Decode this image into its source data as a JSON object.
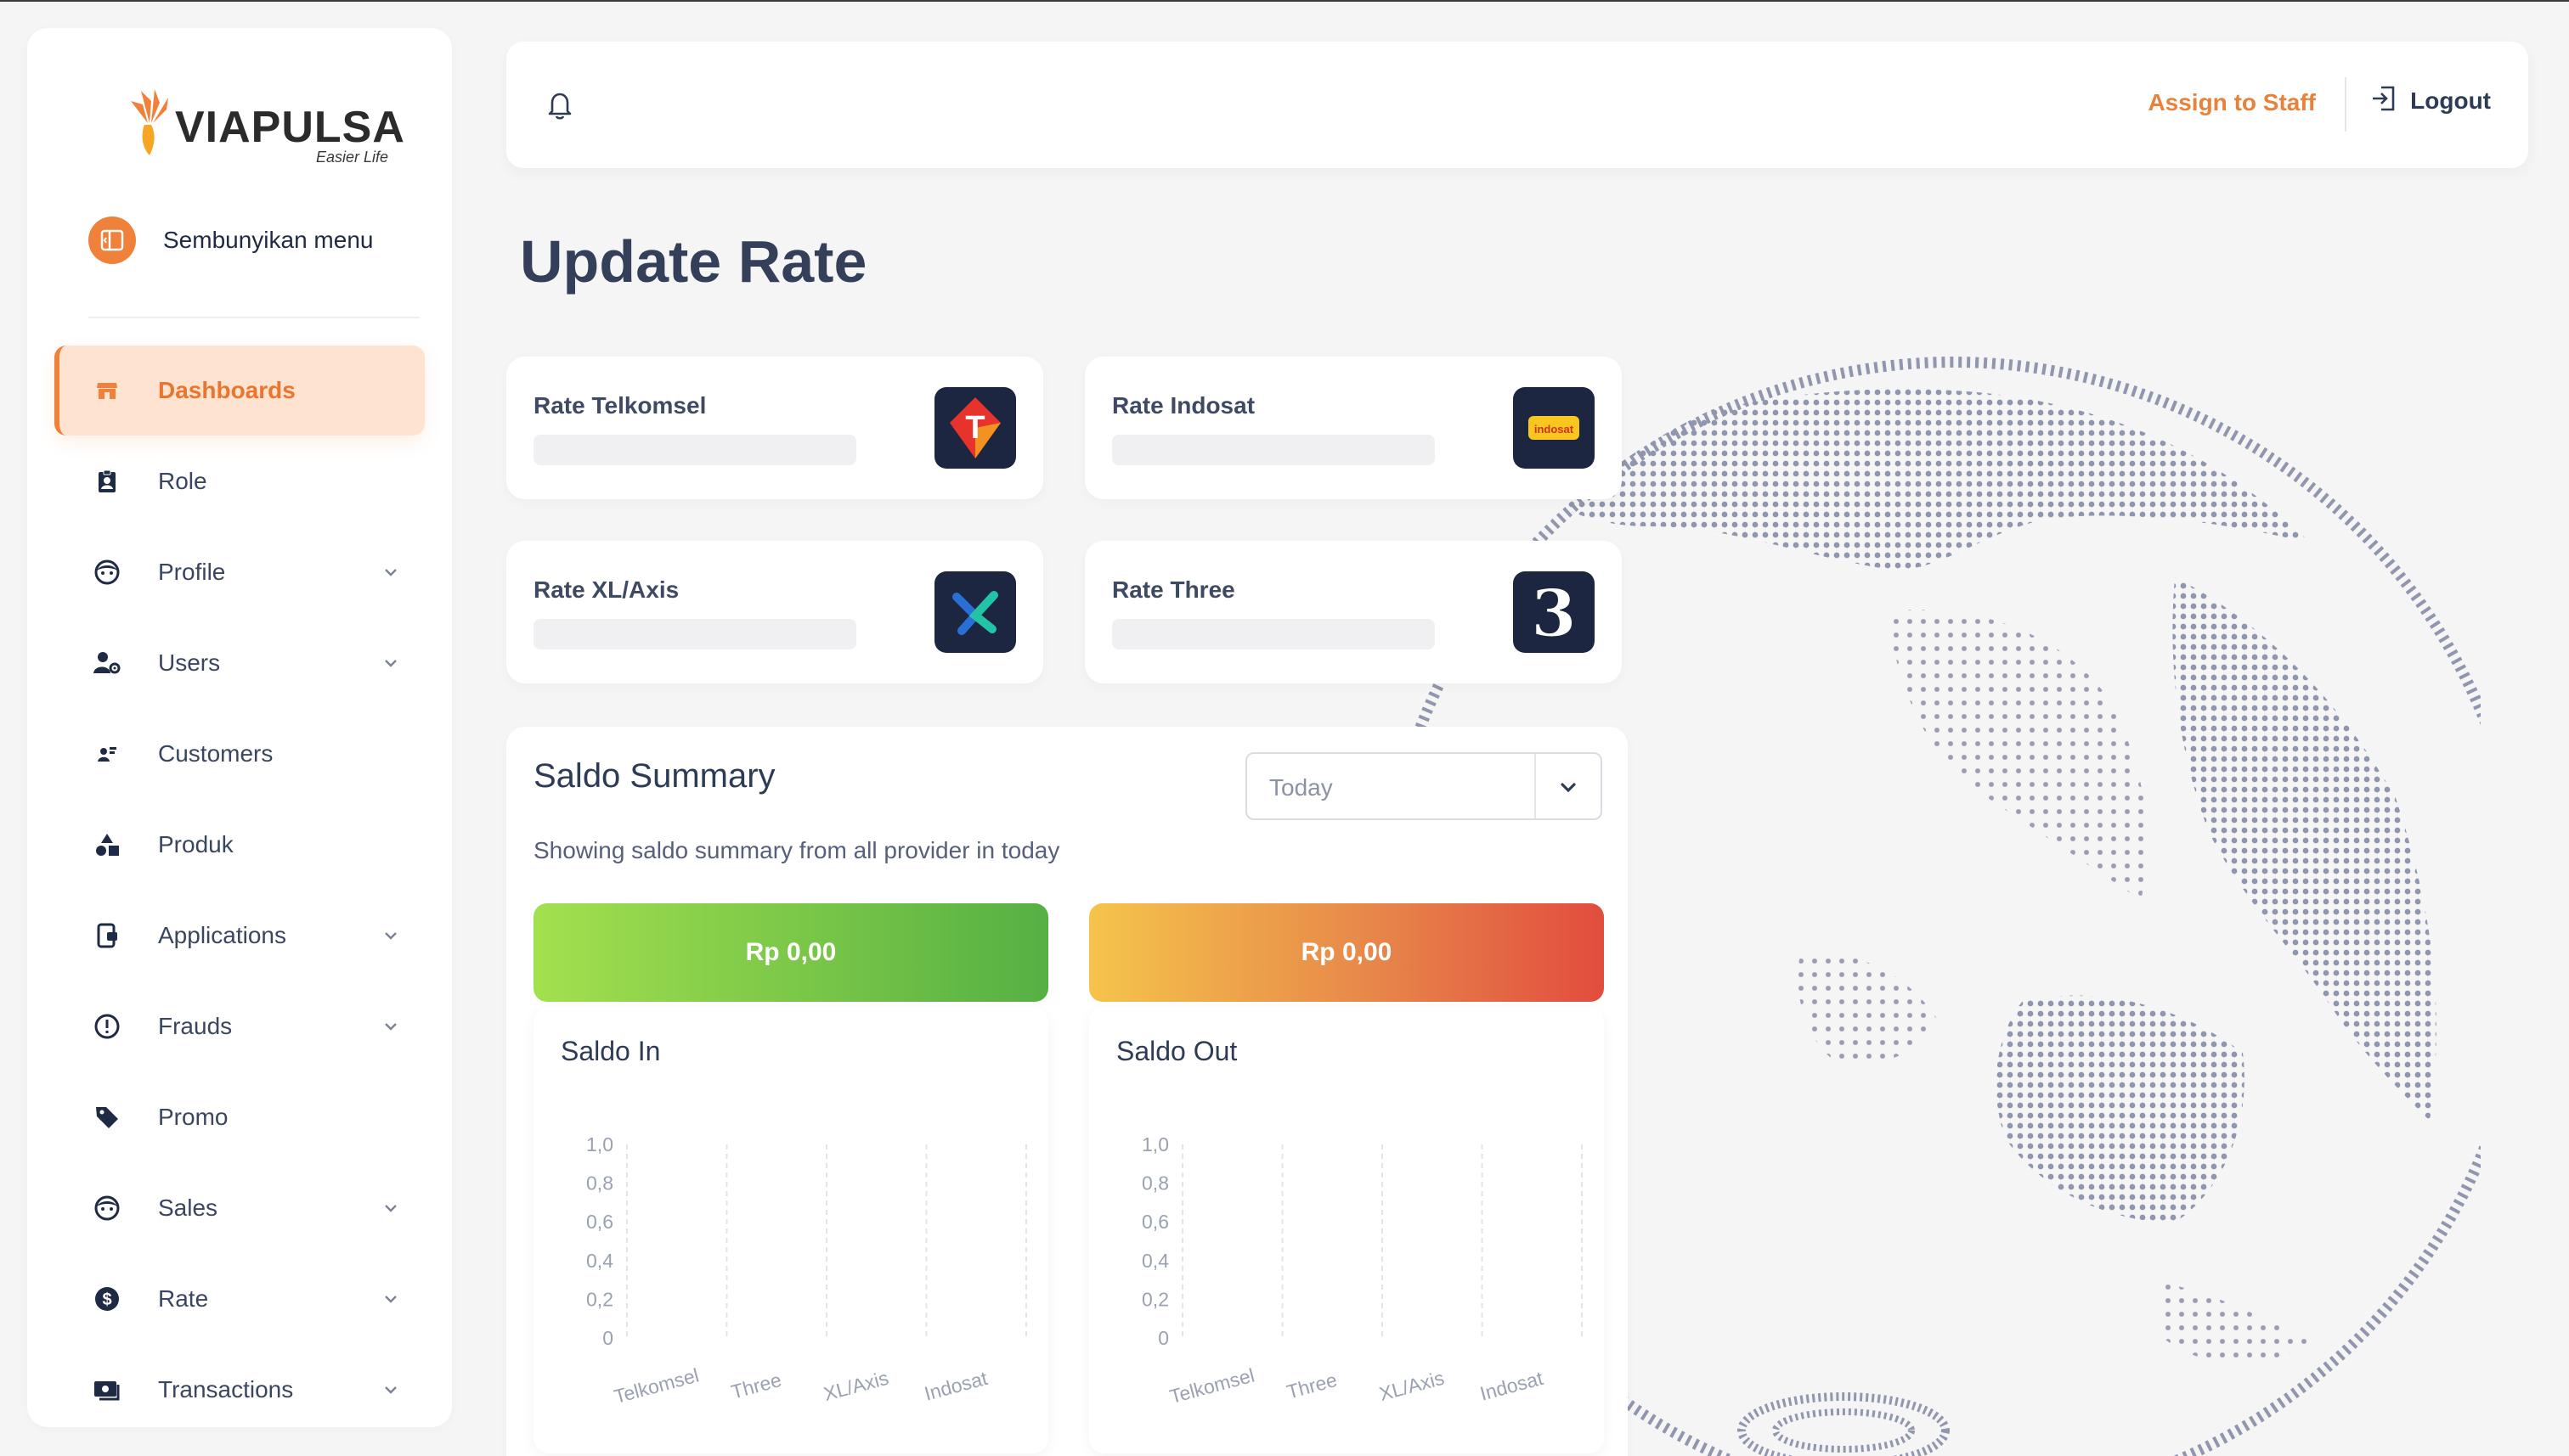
{
  "brand": {
    "name": "VIAPULSA",
    "tagline": "Easier Life",
    "accent": "#f0813a"
  },
  "sidebar": {
    "hide_menu_label": "Sembunyikan menu",
    "items": [
      {
        "label": "Dashboards",
        "icon": "store-icon",
        "active": true,
        "has_submenu": false
      },
      {
        "label": "Role",
        "icon": "id-badge-icon",
        "active": false,
        "has_submenu": false
      },
      {
        "label": "Profile",
        "icon": "face-icon",
        "active": false,
        "has_submenu": true
      },
      {
        "label": "Users",
        "icon": "user-gear-icon",
        "active": false,
        "has_submenu": true
      },
      {
        "label": "Customers",
        "icon": "customer-icon",
        "active": false,
        "has_submenu": false
      },
      {
        "label": "Produk",
        "icon": "shapes-icon",
        "active": false,
        "has_submenu": false
      },
      {
        "label": "Applications",
        "icon": "app-icon",
        "active": false,
        "has_submenu": true
      },
      {
        "label": "Frauds",
        "icon": "alert-circle-icon",
        "active": false,
        "has_submenu": true
      },
      {
        "label": "Promo",
        "icon": "tag-icon",
        "active": false,
        "has_submenu": false
      },
      {
        "label": "Sales",
        "icon": "face-icon",
        "active": false,
        "has_submenu": true
      },
      {
        "label": "Rate",
        "icon": "dollar-icon",
        "active": false,
        "has_submenu": true
      },
      {
        "label": "Transactions",
        "icon": "cash-icon",
        "active": false,
        "has_submenu": true
      }
    ]
  },
  "header": {
    "assign_label": "Assign to Staff",
    "logout_label": "Logout"
  },
  "page": {
    "title": "Update Rate"
  },
  "rates": [
    {
      "title": "Rate Telkomsel",
      "logo": "T",
      "logo_color": "#e8322c"
    },
    {
      "title": "Rate Indosat",
      "logo": "indosat",
      "logo_color": "#f7c61f"
    },
    {
      "title": "Rate XL/Axis",
      "logo": "X",
      "logo_color": "#2a6fd6"
    },
    {
      "title": "Rate Three",
      "logo": "3",
      "logo_color": "#ffffff"
    }
  ],
  "summary": {
    "title": "Saldo Summary",
    "subtitle": "Showing saldo summary from all provider in today",
    "filter_value": "Today",
    "saldo_in_amount": "Rp 0,00",
    "saldo_out_amount": "Rp 0,00",
    "saldo_in_title": "Saldo In",
    "saldo_out_title": "Saldo Out"
  },
  "chart_data": [
    {
      "type": "bar",
      "title": "Saldo In",
      "categories": [
        "Telkomsel",
        "Three",
        "XL/Axis",
        "Indosat"
      ],
      "values": [
        0,
        0,
        0,
        0
      ],
      "yticks": [
        "0",
        "0,2",
        "0,4",
        "0,6",
        "0,8",
        "1,0"
      ],
      "ylim": [
        0,
        1
      ]
    },
    {
      "type": "bar",
      "title": "Saldo Out",
      "categories": [
        "Telkomsel",
        "Three",
        "XL/Axis",
        "Indosat"
      ],
      "values": [
        0,
        0,
        0,
        0
      ],
      "yticks": [
        "0",
        "0,2",
        "0,4",
        "0,6",
        "0,8",
        "1,0"
      ],
      "ylim": [
        0,
        1
      ]
    }
  ]
}
